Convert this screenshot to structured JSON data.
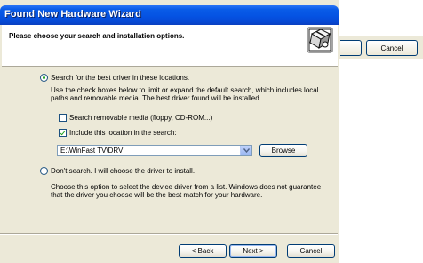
{
  "window": {
    "title": "Found New Hardware Wizard"
  },
  "header": {
    "heading": "Please choose your search and installation options."
  },
  "options": {
    "search_radio_label": "Search for the best driver in these locations.",
    "search_description": "Use the check boxes below to limit or expand the default search, which includes local paths and removable media. The best driver found will be installed.",
    "removable_media_label": "Search removable media (floppy, CD-ROM...)",
    "removable_media_checked": false,
    "include_location_label": "Include this location in the search:",
    "include_location_checked": true,
    "location_value": "E:\\WinFast TV\\DRV",
    "browse_label": "Browse",
    "dont_search_label": "Don't search. I will choose the driver to install.",
    "dont_search_description": "Choose this option to select the device driver from a list.  Windows does not guarantee that the driver you choose will be the best match for your hardware."
  },
  "footer": {
    "back_label": "< Back",
    "next_label": "Next >",
    "cancel_label": "Cancel"
  },
  "background": {
    "cancel_label": "Cancel"
  },
  "icons": {
    "wizard": "hardware-wizard-icon",
    "dropdown": "chevron-down-icon"
  }
}
